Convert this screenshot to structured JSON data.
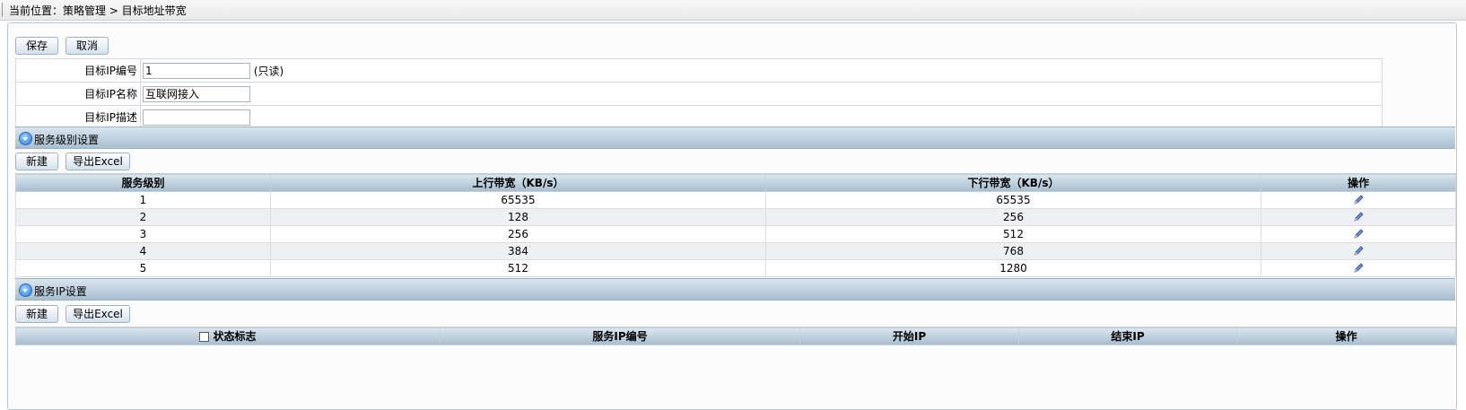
{
  "breadcrumb": "当前位置：策略管理 > 目标地址带宽",
  "toolbar": {
    "save_label": "保存",
    "cancel_label": "取消"
  },
  "form": {
    "id_label": "目标IP编号",
    "id_value": "1",
    "readonly_note": "(只读)",
    "name_label": "目标IP名称",
    "name_value": "互联网接入",
    "desc_label": "目标IP描述",
    "desc_value": ""
  },
  "service_level": {
    "title": "服务级别设置",
    "new_label": "新建",
    "export_label": "导出Excel",
    "headers": [
      "服务级别",
      "上行带宽（KB/s）",
      "下行带宽（KB/s）",
      "操作"
    ],
    "rows": [
      [
        "1",
        "65535",
        "65535"
      ],
      [
        "2",
        "128",
        "256"
      ],
      [
        "3",
        "256",
        "512"
      ],
      [
        "4",
        "384",
        "768"
      ],
      [
        "5",
        "512",
        "1280"
      ]
    ],
    "edit_icon": "pencil-icon"
  },
  "service_ip": {
    "title": "服务IP设置",
    "new_label": "新建",
    "export_label": "导出Excel",
    "headers": [
      "状态标志",
      "服务IP编号",
      "开始IP",
      "结束IP",
      "操作"
    ]
  },
  "colors": {
    "header_grad_top": "#dce7ef",
    "header_grad_bottom": "#a6bdce",
    "row_alt": "#eef0f3"
  }
}
